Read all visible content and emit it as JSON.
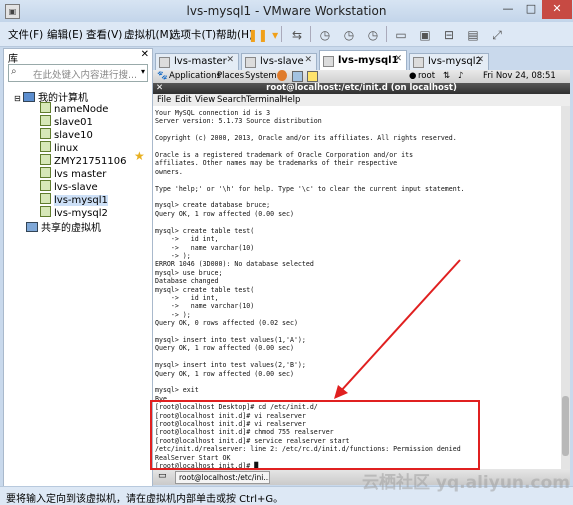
{
  "window": {
    "title": "lvs-mysql1 - VMware Workstation",
    "app_icon": "vmware-icon",
    "min_label": "—",
    "max_label": "□",
    "close_label": "✕"
  },
  "menu": {
    "items": [
      "文件(F)",
      "编辑(E)",
      "查看(V)",
      "虚拟机(M)",
      "选项卡(T)",
      "帮助(H)"
    ]
  },
  "toolbar": {
    "pause_label": "❚❚ ▾",
    "icons": [
      "⇆",
      "◷",
      "◷",
      "◷",
      "▭",
      "▣",
      "⊟",
      "▤",
      "⤢"
    ]
  },
  "library": {
    "title": "库",
    "close_label": "✕",
    "search_placeholder": "在此处键入内容进行搜...",
    "search_icon": "🔍",
    "tree": [
      {
        "label": "我的计算机",
        "type": "folder",
        "expander": "⊟"
      },
      {
        "label": "nameNode",
        "type": "vm"
      },
      {
        "label": "slave01",
        "type": "vm"
      },
      {
        "label": "slave10",
        "type": "vm"
      },
      {
        "label": "linux",
        "type": "vm"
      },
      {
        "label": "ZMY21751106",
        "type": "vm"
      },
      {
        "label": "lvs master",
        "type": "vm"
      },
      {
        "label": "lvs-slave",
        "type": "vm"
      },
      {
        "label": "lvs-mysql1",
        "type": "vm",
        "selected": true
      },
      {
        "label": "lvs-mysql2",
        "type": "vm"
      },
      {
        "label": "共享的虚拟机",
        "type": "shared"
      }
    ],
    "star_icon": "★"
  },
  "tabs": [
    {
      "label": "lvs-master",
      "active": false
    },
    {
      "label": "lvs-slave",
      "active": false
    },
    {
      "label": "lvs-mysql1",
      "active": true
    },
    {
      "label": "lvs-mysql2",
      "active": false
    }
  ],
  "tab_close": "✕",
  "guest": {
    "panel": {
      "applications": "Applications",
      "places": "Places",
      "system": "System",
      "clock": "Fri Nov 24, 08:51",
      "user": "root"
    },
    "terminal": {
      "title": "root@localhost:/etc/init.d (on localhost)",
      "close": "✕",
      "menu": [
        "File",
        "Edit",
        "View",
        "Search",
        "Terminal",
        "Help"
      ],
      "lines": [
        "Your MySQL connection id is 3",
        "Server version: 5.1.73 Source distribution",
        "",
        "Copyright (c) 2000, 2013, Oracle and/or its affiliates. All rights reserved.",
        "",
        "Oracle is a registered trademark of Oracle Corporation and/or its",
        "affiliates. Other names may be trademarks of their respective",
        "owners.",
        "",
        "Type 'help;' or '\\h' for help. Type '\\c' to clear the current input statement.",
        "",
        "mysql> create database bruce;",
        "Query OK, 1 row affected (0.00 sec)",
        "",
        "mysql> create table test(",
        "    ->   id int,",
        "    ->   name varchar(10)",
        "    -> );",
        "ERROR 1046 (3D000): No database selected",
        "mysql> use bruce;",
        "Database changed",
        "mysql> create table test(",
        "    ->   id int,",
        "    ->   name varchar(10)",
        "    -> );",
        "Query OK, 0 rows affected (0.02 sec)",
        "",
        "mysql> insert into test values(1,'A');",
        "Query OK, 1 row affected (0.00 sec)",
        "",
        "mysql> insert into test values(2,'B');",
        "Query OK, 1 row affected (0.00 sec)",
        "",
        "mysql> exit",
        "Bye",
        "[root@localhost Desktop]# cd /etc/init.d/",
        "[root@localhost init.d]# vi realserver",
        "[root@localhost init.d]# vi realserver",
        "[root@localhost init.d]# chmod 755 realserver",
        "[root@localhost init.d]# service realserver start",
        "/etc/init.d/realserver: line 2: /etc/rc.d/init.d/functions: Permission denied",
        "RealServer Start OK",
        "[root@localhost init.d]# █"
      ]
    },
    "taskbar_item": "root@localhost:/etc/ini..."
  },
  "status": {
    "text": "要将输入定向到该虚拟机，请在虚拟机内部单击或按 Ctrl+G。"
  },
  "watermark": "云栖社区 yq.aliyun.com",
  "colors": {
    "highlight": "#e02020",
    "accent": "#c74a43"
  }
}
